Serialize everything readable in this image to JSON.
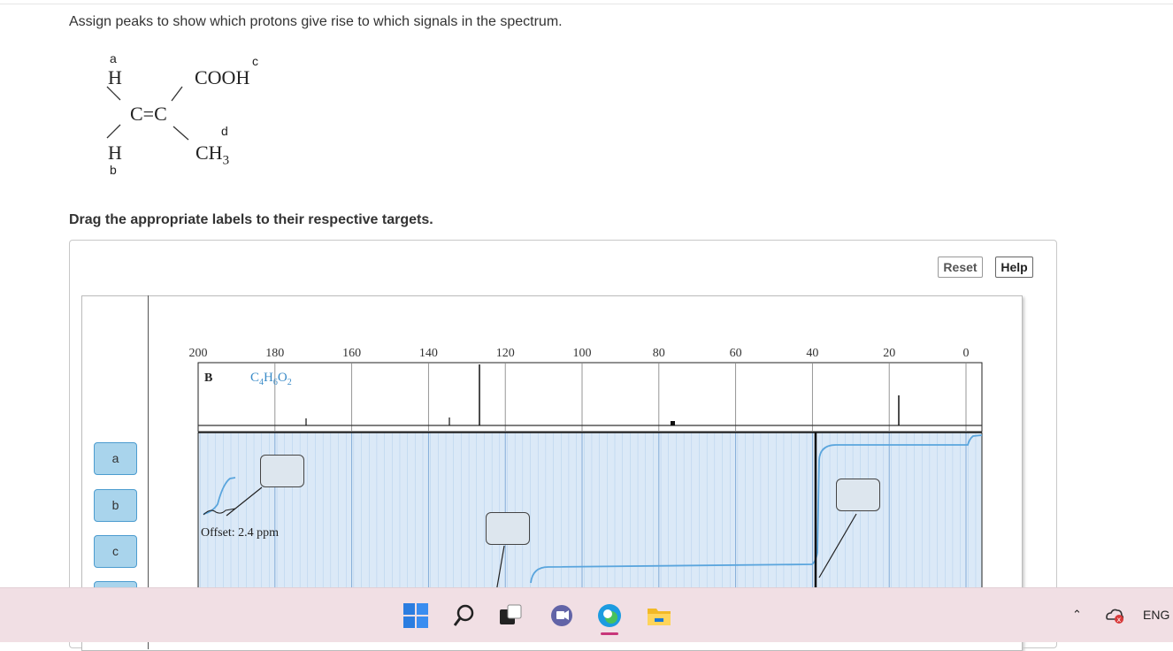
{
  "question": {
    "instruction": "Assign peaks to show which protons give rise to which signals in the spectrum.",
    "drag_instruction": "Drag the appropriate labels to their respective targets."
  },
  "molecule": {
    "labels": {
      "a": "a",
      "b": "b",
      "c": "c",
      "d": "d"
    },
    "atoms": {
      "h_top": "H",
      "h_bottom": "H",
      "cooh": "COOH",
      "double_bond": "C=C",
      "ch3_main": "CH",
      "ch3_sub": "3"
    }
  },
  "buttons": {
    "reset": "Reset",
    "help": "Help"
  },
  "palette": {
    "chips": [
      "a",
      "b",
      "c"
    ]
  },
  "spectrum": {
    "x_ticks": [
      "200",
      "180",
      "160",
      "140",
      "120",
      "100",
      "80",
      "60",
      "40",
      "20",
      "0"
    ],
    "panel_letter": "B",
    "formula": {
      "c": "C",
      "c_n": "4",
      "h": "H",
      "h_n": "6",
      "o": "O",
      "o_n": "2"
    },
    "offset_text": "Offset: 2.4 ppm"
  },
  "colors": {
    "chip": "#a9d4ec",
    "grid_bg": "#dbe9f7",
    "integral": "#5aa5dd"
  },
  "taskbar": {
    "icons": [
      "windows-start-icon",
      "search-icon",
      "task-view-icon",
      "teams-chat-icon",
      "edge-browser-icon",
      "file-explorer-icon"
    ],
    "tray_language": "ENG"
  }
}
